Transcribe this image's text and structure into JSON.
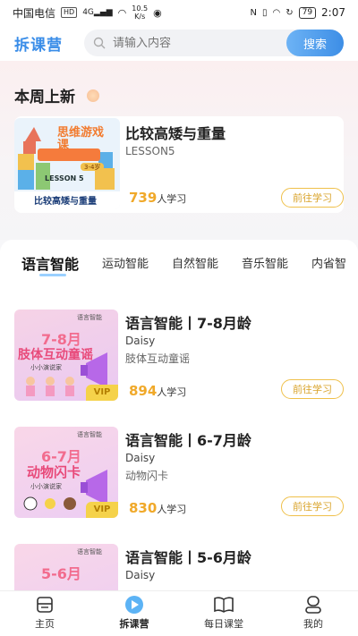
{
  "status_bar": {
    "carrier": "中国电信",
    "hd": "HD",
    "network": "4G",
    "speed": "10.5",
    "speed_unit": "K/s",
    "battery": "79",
    "time": "2:07"
  },
  "header": {
    "logo": "拆课营",
    "search_placeholder": "请输入内容",
    "search_button": "搜索"
  },
  "weekly": {
    "title": "本周上新",
    "card": {
      "thumb_title": "思维游戏课",
      "thumb_age": "3-4岁",
      "thumb_lesson": "LESSON 5",
      "thumb_caption": "比较高矮与重量",
      "title": "比较高矮与重量",
      "subtitle": "LESSON5",
      "count": "739",
      "count_unit": "人学习",
      "button": "前往学习"
    }
  },
  "tabs": [
    "语言智能",
    "运动智能",
    "自然智能",
    "音乐智能",
    "内省智"
  ],
  "courses": [
    {
      "thumb_tag": "语言智能",
      "thumb_age": "7-8月",
      "thumb_name": "肢体互动童谣",
      "thumb_brand": "小小演说家",
      "thumb_vip": "VIP",
      "title": "语言智能丨7-8月龄",
      "author": "Daisy",
      "desc": "肢体互动童谣",
      "count": "894",
      "count_unit": "人学习",
      "button": "前往学习"
    },
    {
      "thumb_tag": "语言智能",
      "thumb_age": "6-7月",
      "thumb_name": "动物闪卡",
      "thumb_brand": "小小演说家",
      "thumb_vip": "VIP",
      "title": "语言智能丨6-7月龄",
      "author": "Daisy",
      "desc": "动物闪卡",
      "count": "830",
      "count_unit": "人学习",
      "button": "前往学习"
    },
    {
      "thumb_tag": "语言智能",
      "thumb_age": "5-6月",
      "thumb_name": "",
      "thumb_brand": "",
      "thumb_vip": "",
      "title": "语言智能丨5-6月龄",
      "author": "Daisy",
      "desc": "",
      "count": "",
      "count_unit": "",
      "button": ""
    }
  ],
  "tabbar": {
    "items": [
      {
        "label": "主页",
        "icon": "home-icon"
      },
      {
        "label": "拆课营",
        "icon": "play-icon"
      },
      {
        "label": "每日课堂",
        "icon": "book-icon"
      },
      {
        "label": "我的",
        "icon": "profile-icon"
      }
    ],
    "active_index": 1
  },
  "colors": {
    "accent_blue": "#3d8ee6",
    "accent_gold": "#f0a92a"
  }
}
